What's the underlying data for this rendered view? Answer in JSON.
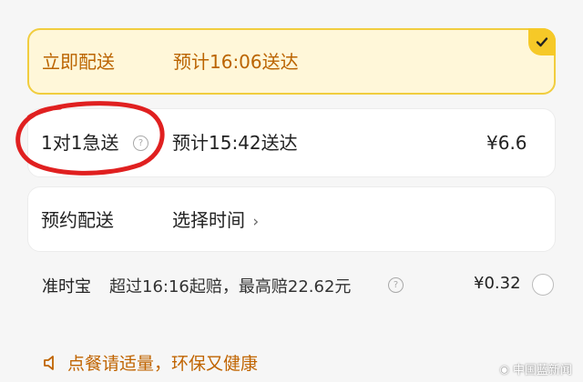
{
  "immediate": {
    "title": "立即配送",
    "eta": "预计16:06送达",
    "selected": true
  },
  "express": {
    "title": "1对1急送",
    "eta": "预计15:42送达",
    "price": "¥6.6"
  },
  "reserve": {
    "title": "预约配送",
    "action": "选择时间"
  },
  "insurance": {
    "name": "准时宝",
    "desc": "超过16:16起赔，最高赔22.62元",
    "price": "¥0.32"
  },
  "tip": {
    "text": "点餐请适量，环保又健康"
  },
  "watermark": {
    "text": "中国蓝新闻"
  },
  "colors": {
    "accent": "#f6c928",
    "annotation": "#e02020",
    "tip": "#c06400"
  }
}
